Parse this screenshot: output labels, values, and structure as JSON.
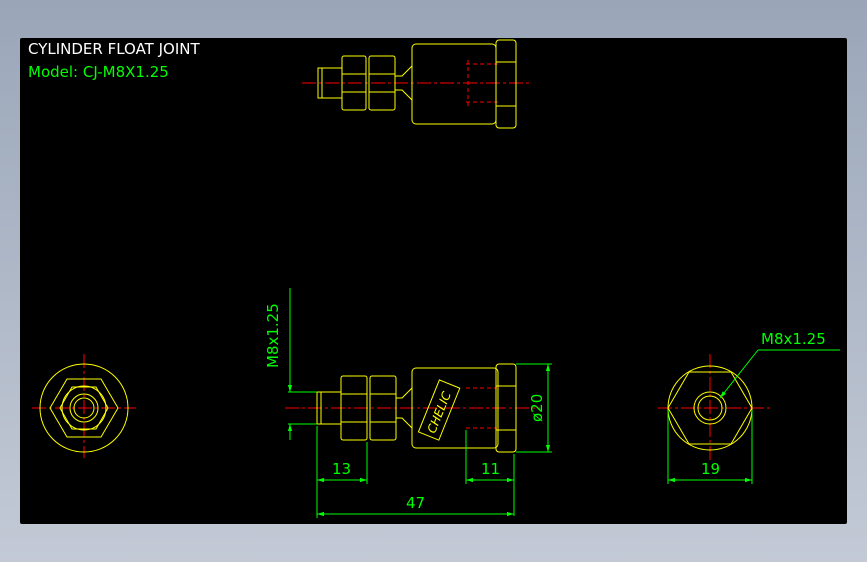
{
  "title": "CYLINDER FLOAT JOINT",
  "model_label": "Model: CJ-M8X1.25",
  "brand_label": "CHELIC",
  "colors": {
    "background": "#000000",
    "outline": "#ffff00",
    "centerline": "#ff0000",
    "dimension": "#00ff00",
    "hidden": "#ff0000",
    "frame": "#9aa6b8"
  },
  "dimensions": {
    "thread_vertical": "M8x1.25",
    "thread_callout": "M8x1.25",
    "diameter": "ø20",
    "length_13": "13",
    "length_11": "11",
    "length_47": "47",
    "width_19": "19"
  }
}
